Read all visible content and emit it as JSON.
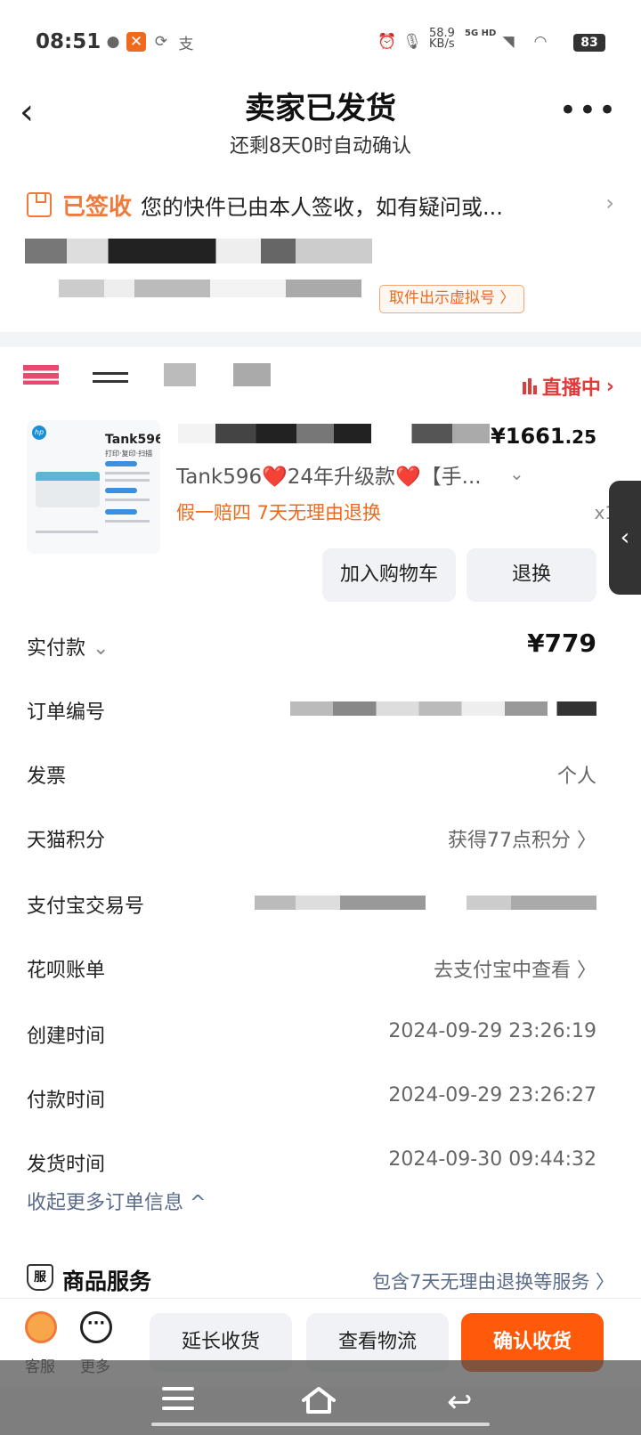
{
  "status_bar": {
    "time": "08:51",
    "net_speed": "58.9",
    "net_unit": "KB/s",
    "signal_label": "5G HD",
    "battery": "83"
  },
  "header": {
    "title": "卖家已发货",
    "subtitle": "还剩8天0时自动确认"
  },
  "logistics": {
    "status": "已签收",
    "message": "您的快件已由本人签收，如有疑问或...",
    "virtual_number_button": "取件出示虚拟号 〉"
  },
  "shop": {
    "live_label": "直播中"
  },
  "goods": {
    "thumb_model": "Tank596",
    "thumb_sub": "打印·复印·扫描",
    "thumb_brand": "hp",
    "name": "Tank596❤️24年升级款❤️【手...",
    "tags": "假一赔四  7天无理由退换",
    "price_int": "¥1661",
    "price_dec": ".25",
    "qty": "x1",
    "add_cart": "加入购物车",
    "return": "退换"
  },
  "order_info": [
    {
      "label": "实付款",
      "value": "¥779"
    },
    {
      "label": "订单编号",
      "value": ""
    },
    {
      "label": "发票",
      "value": "个人"
    },
    {
      "label": "天猫积分",
      "value": "获得77点积分 〉"
    },
    {
      "label": "支付宝交易号",
      "value": ""
    },
    {
      "label": "花呗账单",
      "value": "去支付宝中查看 〉"
    },
    {
      "label": "创建时间",
      "value": "2024-09-29 23:26:19"
    },
    {
      "label": "付款时间",
      "value": "2024-09-29 23:26:27"
    },
    {
      "label": "发货时间",
      "value": "2024-09-30 09:44:32"
    }
  ],
  "collapse_label": "收起更多订单信息 ^",
  "service": {
    "icon_text": "服",
    "title": "商品服务",
    "desc": "包含7天无理由退换等服务 〉"
  },
  "bottom_bar": {
    "cs_label": "客服",
    "more_label": "更多",
    "extend": "延长收货",
    "logistics": "查看物流",
    "confirm": "确认收货"
  },
  "colors": {
    "accent_orange": "#ef6a1e",
    "live_red": "#e03a3a",
    "primary_button": "#ff5a0a",
    "link_blue_gray": "#5b6b8a"
  },
  "icons": [
    "back-icon",
    "more-icon",
    "box-icon",
    "chevron-right-icon",
    "chevron-down-icon",
    "live-icon",
    "customer-service-icon",
    "shield-icon",
    "menu-icon",
    "home-icon",
    "nav-back-icon"
  ]
}
